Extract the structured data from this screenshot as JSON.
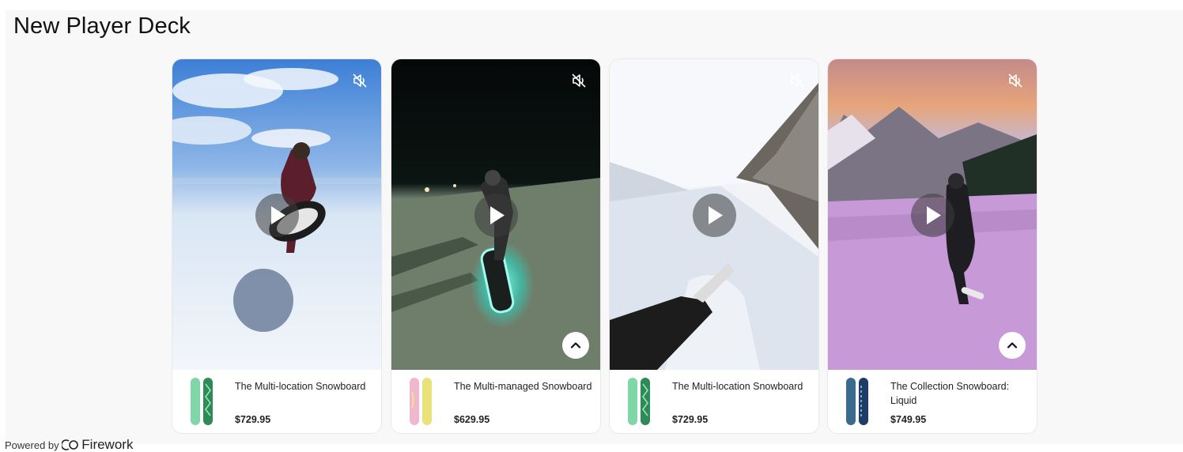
{
  "page": {
    "title": "New Player Deck"
  },
  "cards": [
    {
      "product_name": "The Multi-location Snowboard",
      "price": "$729.95",
      "board_colors": [
        "#7fd6a6",
        "#2f8a57"
      ],
      "has_expand_button": false
    },
    {
      "product_name": "The Multi-managed Snowboard",
      "price": "$629.95",
      "board_colors": [
        "#f0b8cf",
        "#e9e27a"
      ],
      "has_expand_button": true
    },
    {
      "product_name": "The Multi-location Snowboard",
      "price": "$729.95",
      "board_colors": [
        "#7fd6a6",
        "#2f8a57"
      ],
      "has_expand_button": false
    },
    {
      "product_name": "The Collection Snowboard: Liquid",
      "price": "$749.95",
      "board_colors": [
        "#3b6a8f",
        "#1d3d66"
      ],
      "has_expand_button": true
    }
  ],
  "footer": {
    "powered_by": "Powered by",
    "brand": "Firework"
  },
  "icons": {
    "mute": "muted-speaker-icon",
    "play": "play-icon",
    "expand": "chevron-up-icon",
    "brand_logo": "firework-logo-icon"
  }
}
